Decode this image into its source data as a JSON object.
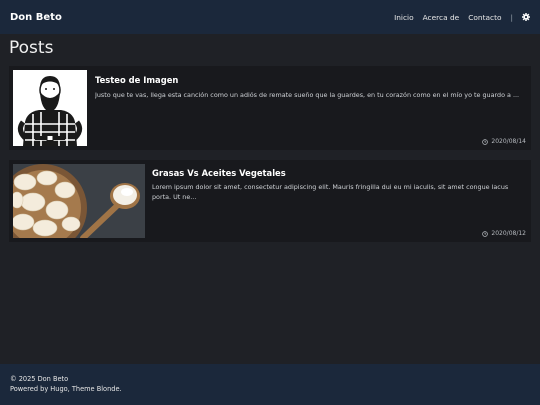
{
  "header": {
    "brand": "Don Beto",
    "nav": [
      {
        "label": "Inicio"
      },
      {
        "label": "Acerca de"
      },
      {
        "label": "Contacto"
      }
    ],
    "separator": "|",
    "settings_icon": "gear-icon"
  },
  "main": {
    "title": "Posts",
    "posts": [
      {
        "title": "Testeo de Imagen",
        "excerpt": "Justo que te vas, llega esta canción como un adiós de remate sueño que la guardes, en tu corazón como en el mío yo te guardo a ...",
        "date": "2020/08/14",
        "image": "lumberjack-illustration"
      },
      {
        "title": "Grasas Vs Aceites Vegetales",
        "excerpt": "Lorem ipsum dolor sit amet, consectetur adipiscing elit. Mauris fringilla dui eu mi iaculis, sit amet congue lacus porta. Ut ne...",
        "date": "2020/08/12",
        "image": "garlic-bowl-photo"
      }
    ]
  },
  "footer": {
    "copyright": "© 2025 Don Beto",
    "powered": "Powered by Hugo, Theme Blonde."
  },
  "colors": {
    "navbar": "#1b283b",
    "background": "#1f2126",
    "card": "#18191d"
  }
}
